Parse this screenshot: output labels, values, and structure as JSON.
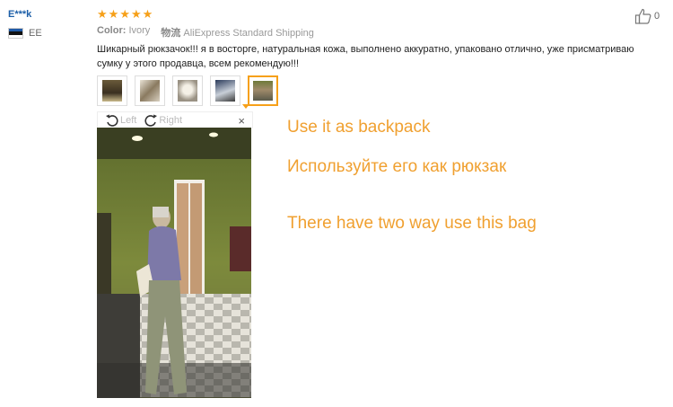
{
  "reviewer": {
    "name": "E***k",
    "country_code": "EE",
    "flag_colors": [
      "#1f5aa6",
      "#111111",
      "#ffffff"
    ]
  },
  "review": {
    "rating": 5,
    "color_label": "Color:",
    "color_value": "Ivory",
    "shipping_label": "物流",
    "shipping_value": "AliExpress Standard Shipping",
    "text": "Шикарный рюкзачок!!! я в восторге, натуральная кожа, выполнено аккуратно, упаковано отлично, уже присматриваю сумку у этого продавца, всем рекомендую!!!",
    "likes": "0"
  },
  "thumbnails": [
    {
      "name": "photo-1",
      "active": false
    },
    {
      "name": "photo-2",
      "active": false
    },
    {
      "name": "photo-3",
      "active": false
    },
    {
      "name": "photo-4",
      "active": false
    },
    {
      "name": "photo-5",
      "active": true
    }
  ],
  "viewer": {
    "left_label": "Left",
    "right_label": "Right",
    "close_label": "×"
  },
  "captions": {
    "line1": "Use it as backpack",
    "line2": "Используйте его как рюкзак",
    "line3": "There have two way use this bag"
  },
  "colors": {
    "accent": "#f6a019",
    "caption": "#f0a030",
    "link": "#1d5fa8"
  },
  "icons": [
    "star-icon",
    "thumb-up-icon",
    "rotate-left-icon",
    "rotate-right-icon",
    "close-icon"
  ]
}
